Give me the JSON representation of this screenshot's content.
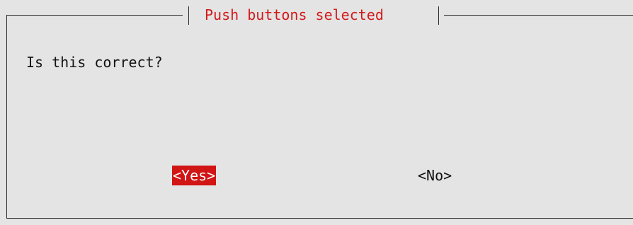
{
  "dialog": {
    "title": "Push buttons selected",
    "message": "Is this correct?",
    "buttons": {
      "yes_label": "<Yes>",
      "no_label": "<No>",
      "selected": "yes"
    }
  },
  "colors": {
    "background": "#e4e4e4",
    "title": "#d21a1a",
    "selected_button_bg": "#d11414",
    "selected_button_text": "#ffffff",
    "text": "#111111"
  }
}
